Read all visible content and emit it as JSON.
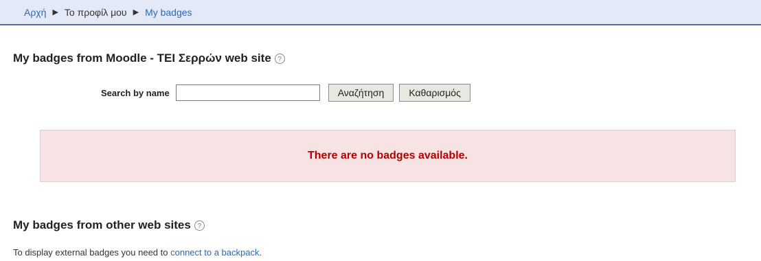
{
  "breadcrumb": {
    "items": [
      "Αρχή",
      "Το προφίλ μου",
      "My badges"
    ],
    "separator": "▶"
  },
  "section_local": {
    "title": "My badges from Moodle - TEI Σερρών web site",
    "help_icon": "question-circle-icon"
  },
  "search": {
    "label": "Search by name",
    "value": "",
    "search_button": "Αναζήτηση",
    "clear_button": "Καθαρισμός"
  },
  "notice": {
    "text": "There are no badges available.",
    "background": "#f7e3e3",
    "text_color": "#b30000"
  },
  "section_external": {
    "title": "My badges from other web sites",
    "help_icon": "question-circle-icon",
    "text_prefix": "To display external badges you need to ",
    "link_text": "connect to a backpack",
    "text_suffix": "."
  },
  "colors": {
    "link": "#2a68b8",
    "breadcrumb_bg": "#e3e9f6"
  }
}
